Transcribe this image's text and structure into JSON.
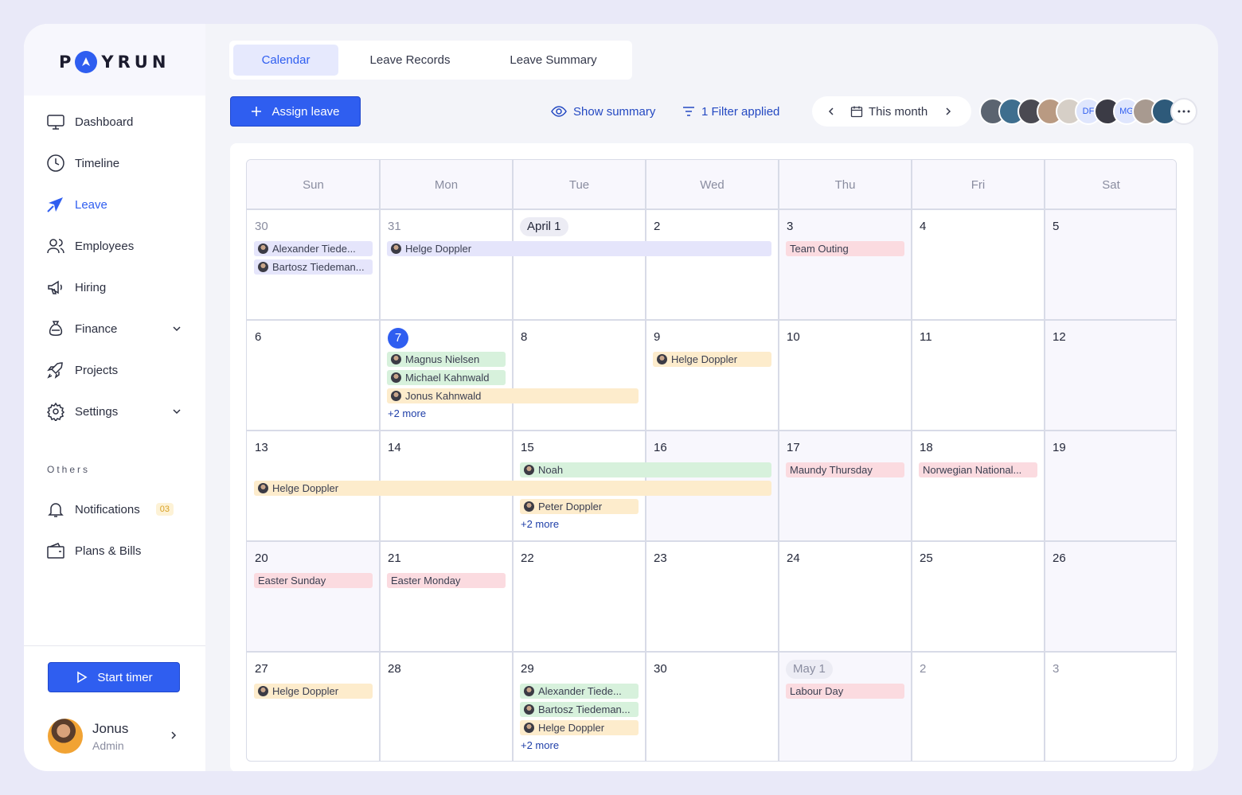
{
  "brand": {
    "logo_left": "P",
    "logo_right": "YRUN"
  },
  "sidebar": {
    "items": [
      {
        "label": "Dashboard"
      },
      {
        "label": "Timeline"
      },
      {
        "label": "Leave"
      },
      {
        "label": "Employees"
      },
      {
        "label": "Hiring"
      },
      {
        "label": "Finance"
      },
      {
        "label": "Projects"
      },
      {
        "label": "Settings"
      }
    ],
    "others_label": "Others",
    "others": [
      {
        "label": "Notifications",
        "badge": "03"
      },
      {
        "label": "Plans & Bills"
      }
    ],
    "start_timer": "Start timer",
    "user": {
      "name": "Jonus",
      "role": "Admin"
    }
  },
  "tabs": [
    {
      "label": "Calendar",
      "active": true
    },
    {
      "label": "Leave Records",
      "active": false
    },
    {
      "label": "Leave Summary",
      "active": false
    }
  ],
  "toolbar": {
    "assign_leave": "Assign leave",
    "show_summary": "Show summary",
    "filter": "1 Filter applied",
    "period": "This month"
  },
  "team_avatars": {
    "initials": [
      "DF",
      "MG"
    ]
  },
  "colors": {
    "accent": "#2f5ef0",
    "event_purple": "#e5e5fb",
    "event_red": "#fbdbe0",
    "event_green": "#d7f1dc",
    "event_yellow": "#fdeccc"
  },
  "calendar": {
    "weekdays": [
      "Sun",
      "Mon",
      "Tue",
      "Wed",
      "Thu",
      "Fri",
      "Sat"
    ],
    "days": [
      "30",
      "31",
      "April 1",
      "2",
      "3",
      "4",
      "5",
      "6",
      "7",
      "8",
      "9",
      "10",
      "11",
      "12",
      "13",
      "14",
      "15",
      "16",
      "17",
      "18",
      "19",
      "20",
      "21",
      "22",
      "23",
      "24",
      "25",
      "26",
      "27",
      "28",
      "29",
      "30",
      "May 1",
      "2",
      "3"
    ],
    "events": [
      {
        "label": "Alexander Tiede...",
        "color": "purple",
        "avatar": true
      },
      {
        "label": "Bartosz Tiedeman...",
        "color": "purple",
        "avatar": true
      },
      {
        "label": "Helge Doppler",
        "color": "purple",
        "avatar": true
      },
      {
        "label": "Team Outing",
        "color": "red",
        "avatar": false
      },
      {
        "label": "Magnus Nielsen",
        "color": "green",
        "avatar": true
      },
      {
        "label": "Michael Kahnwald",
        "color": "green",
        "avatar": true
      },
      {
        "label": "Jonus Kahnwald",
        "color": "yellow",
        "avatar": true
      },
      {
        "label": "Helge Doppler",
        "color": "yellow",
        "avatar": true
      },
      {
        "label": "Noah",
        "color": "green",
        "avatar": true
      },
      {
        "label": "Helge Doppler",
        "color": "yellow",
        "avatar": true
      },
      {
        "label": "Peter Doppler",
        "color": "yellow",
        "avatar": true
      },
      {
        "label": "Maundy Thursday",
        "color": "red",
        "avatar": false
      },
      {
        "label": "Norwegian National...",
        "color": "red",
        "avatar": false
      },
      {
        "label": "Easter Sunday",
        "color": "red",
        "avatar": false
      },
      {
        "label": "Easter Monday",
        "color": "red",
        "avatar": false
      },
      {
        "label": "Helge Doppler",
        "color": "yellow",
        "avatar": true
      },
      {
        "label": "Alexander Tiede...",
        "color": "green",
        "avatar": true
      },
      {
        "label": "Bartosz Tiedeman...",
        "color": "green",
        "avatar": true
      },
      {
        "label": "Helge Doppler",
        "color": "yellow",
        "avatar": true
      },
      {
        "label": "Labour Day",
        "color": "red",
        "avatar": false
      }
    ],
    "more": [
      "+2 more",
      "+2 more",
      "+2 more"
    ]
  }
}
